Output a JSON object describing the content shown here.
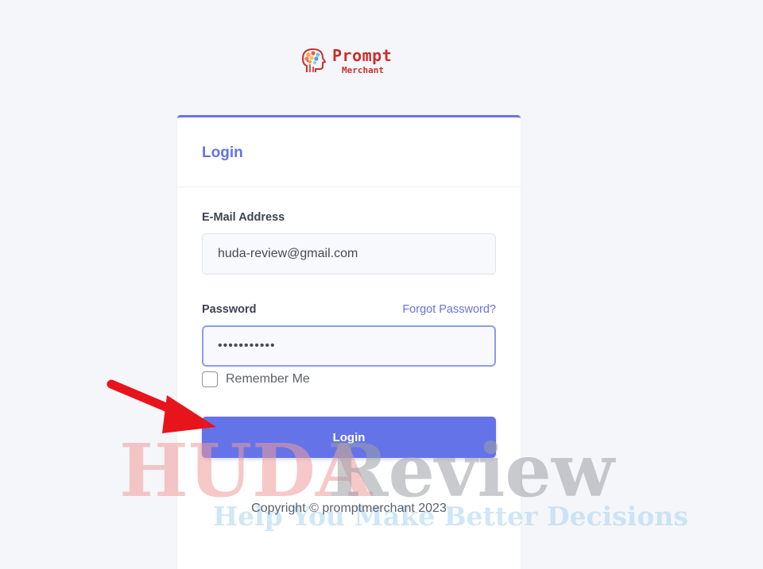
{
  "logo": {
    "title": "Prompt",
    "subtitle": "Merchant"
  },
  "card": {
    "title": "Login"
  },
  "form": {
    "email_label": "E-Mail Address",
    "email_value": "huda-review@gmail.com",
    "password_label": "Password",
    "forgot_link": "Forgot Password?",
    "password_value": "•••••••••••",
    "remember_label": "Remember Me",
    "remember_checked": false,
    "submit_label": "Login"
  },
  "footer": {
    "copyright": "Copyright © promptmerchant 2023"
  },
  "watermark": {
    "brand_part1": "HUDA",
    "brand_part2": "Review",
    "tagline": "Help You Make Better Decisions"
  },
  "colors": {
    "accent": "#6473e8",
    "background": "#f5f6fa",
    "logo_red": "#c9302c",
    "annotation_arrow": "#e8141c"
  },
  "icons": {
    "logo_mark": "head-circuit-icon",
    "annotation": "red-arrow-icon"
  }
}
